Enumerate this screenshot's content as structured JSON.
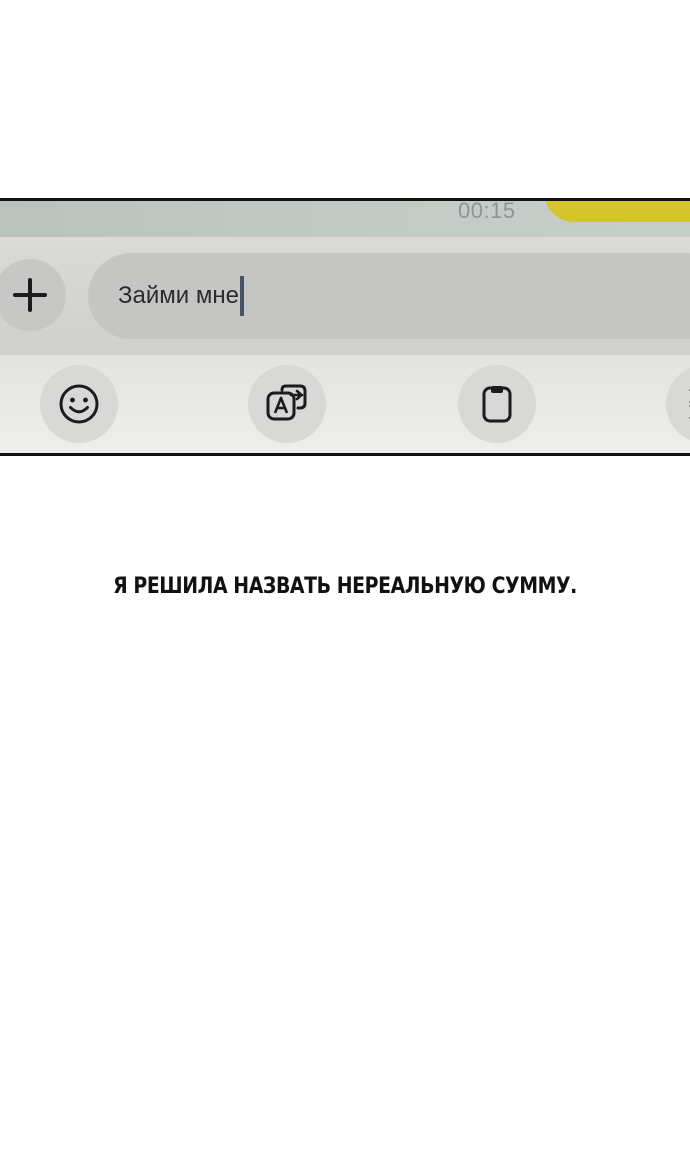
{
  "chat": {
    "timestamp": "00:15",
    "bubble_color": "#d4c52a"
  },
  "composer": {
    "plus_icon": "plus-icon",
    "input_value": "Займи мне",
    "caret_color": "#4a5563"
  },
  "toolbar": {
    "buttons": [
      {
        "icon": "smiley-icon"
      },
      {
        "icon": "translate-icon"
      },
      {
        "icon": "clipboard-icon"
      },
      {
        "icon": "more-icon"
      }
    ]
  },
  "caption": {
    "text": "Я РЕШИЛА НАЗВАТЬ НЕРЕАЛЬНУЮ СУММУ."
  }
}
